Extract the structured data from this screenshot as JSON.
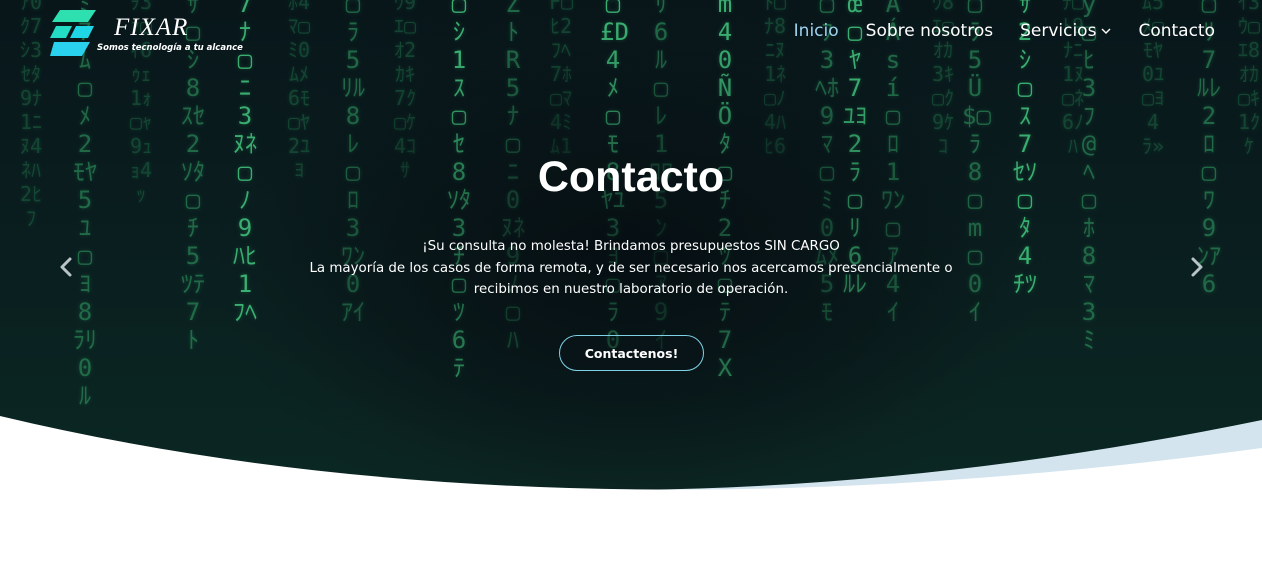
{
  "header": {
    "logo": {
      "brand": "FIXAR",
      "tagline": "Somos tecnología a tu alcance",
      "accent_colors": [
        "#2ee0b0",
        "#1fd6e6"
      ]
    },
    "nav": [
      {
        "label": "Inicio",
        "active": true
      },
      {
        "label": "Sobre nosotros",
        "active": false
      },
      {
        "label": "Servicios",
        "active": false,
        "has_dropdown": true,
        "icon": "chevron-down-icon"
      },
      {
        "label": "Contacto",
        "active": false
      }
    ]
  },
  "hero": {
    "title": "Contacto",
    "lines": [
      "¡Su consulta no molesta! Brindamos presupuestos SIN CARGO",
      "La mayoría de los casos de forma remota, y de ser necesario nos acercamos presencialmente o",
      "recibimos en nuestro laboratorio de operación."
    ],
    "cta_label": "Contactenos!",
    "prev_icon": "chevron-left-icon",
    "next_icon": "chevron-right-icon"
  },
  "colors": {
    "nav_active": "#9ed3f0",
    "cta_border": "#7fd2e6",
    "wave": "#d3e4ee",
    "matrix_green": "#2f9c62"
  }
}
